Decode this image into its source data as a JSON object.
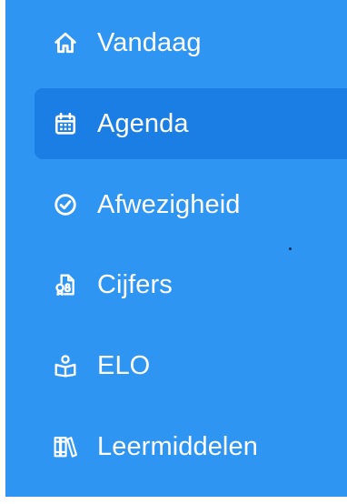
{
  "sidebar": {
    "accent_color": "#2f95f2",
    "active_color": "#1a7ee4",
    "items": [
      {
        "label": "Vandaag",
        "icon": "home-icon",
        "active": false
      },
      {
        "label": "Agenda",
        "icon": "calendar-icon",
        "active": true
      },
      {
        "label": "Afwezigheid",
        "icon": "check-circle-icon",
        "active": false
      },
      {
        "label": "Cijfers",
        "icon": "grade-document-icon",
        "active": false
      },
      {
        "label": "ELO",
        "icon": "study-book-icon",
        "active": false
      },
      {
        "label": "Leermiddelen",
        "icon": "books-icon",
        "active": false
      }
    ]
  }
}
